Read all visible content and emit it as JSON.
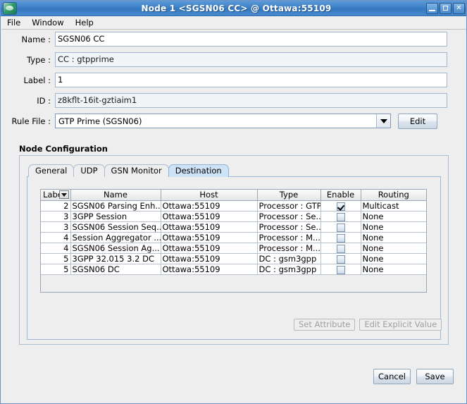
{
  "window": {
    "title": "Node 1 <SGSN06 CC> @ Ottawa:55109",
    "icon": "app-node-icon",
    "controls": {
      "minimize": "minimize-icon",
      "maximize": "maximize-icon",
      "close": "✕"
    }
  },
  "menubar": {
    "items": [
      "File",
      "Window",
      "Help"
    ]
  },
  "form": {
    "fields": [
      {
        "label": "Name :",
        "value": "SGSN06 CC",
        "readonly": false
      },
      {
        "label": "Type :",
        "value": "CC : gtpprime",
        "readonly": true
      },
      {
        "label": "Label :",
        "value": "1",
        "readonly": false
      },
      {
        "label": "ID :",
        "value": "z8kflt-16it-gztiaim1",
        "readonly": true
      }
    ],
    "rule_file": {
      "label": "Rule File :",
      "value": "GTP Prime (SGSN06)",
      "arrow_icon": "chevron-down-icon",
      "edit_button": "Edit"
    }
  },
  "node_configuration": {
    "title": "Node Configuration",
    "tabs": [
      {
        "label": "General",
        "active": false
      },
      {
        "label": "UDP",
        "active": false
      },
      {
        "label": "GSN Monitor",
        "active": false
      },
      {
        "label": "Destination",
        "active": true
      }
    ],
    "table": {
      "columns": [
        "Label",
        "Name",
        "Host",
        "Type",
        "Enable",
        "Routing"
      ],
      "sort_icon": "sort-dropdown-icon",
      "rows": [
        {
          "label": "2",
          "name": "SGSN06 Parsing Enh...",
          "host": "Ottawa:55109",
          "type": "Processor : GTP",
          "enable": true,
          "routing": "Multicast"
        },
        {
          "label": "3",
          "name": "3GPP Session",
          "host": "Ottawa:55109",
          "type": "Processor : Se...",
          "enable": false,
          "routing": "None"
        },
        {
          "label": "3",
          "name": "SGSN06 Session Seq...",
          "host": "Ottawa:55109",
          "type": "Processor : Se...",
          "enable": false,
          "routing": "None"
        },
        {
          "label": "4",
          "name": "Session Aggregator ...",
          "host": "Ottawa:55109",
          "type": "Processor : M...",
          "enable": false,
          "routing": "None"
        },
        {
          "label": "4",
          "name": "SGSN06 Session Ag...",
          "host": "Ottawa:55109",
          "type": "Processor : M...",
          "enable": false,
          "routing": "None"
        },
        {
          "label": "5",
          "name": "3GPP 32.015 3.2 DC",
          "host": "Ottawa:55109",
          "type": "DC : gsm3gpp",
          "enable": false,
          "routing": "None"
        },
        {
          "label": "5",
          "name": "SGSN06 DC",
          "host": "Ottawa:55109",
          "type": "DC : gsm3gpp",
          "enable": false,
          "routing": "None"
        }
      ]
    },
    "actions": {
      "set_attribute": "Set Attribute",
      "edit_explicit_value": "Edit Explicit Value"
    }
  },
  "footer": {
    "cancel": "Cancel",
    "save": "Save"
  },
  "colors": {
    "titlebar": "#3f80c6",
    "active_tab": "#cfe3f7",
    "panel_bg": "#eeeeee",
    "field_border": "#9fb6cd"
  }
}
